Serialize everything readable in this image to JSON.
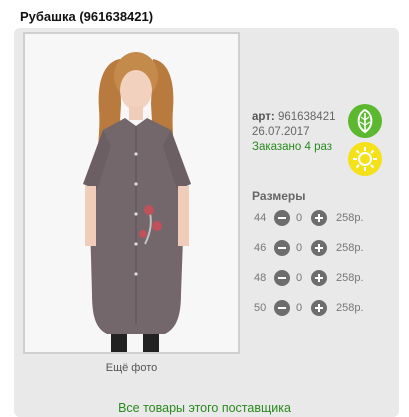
{
  "product": {
    "title": "Рубашка (961638421)",
    "article_label": "арт:",
    "article_value": "961638421",
    "date": "26.07.2017",
    "ordered": "Заказано 4 раз",
    "more_photos": "Ещё фото"
  },
  "sizes": {
    "title": "Размеры",
    "rows": [
      {
        "size": "44",
        "qty": "0",
        "price": "258р."
      },
      {
        "size": "46",
        "qty": "0",
        "price": "258р."
      },
      {
        "size": "48",
        "qty": "0",
        "price": "258р."
      },
      {
        "size": "50",
        "qty": "0",
        "price": "258р."
      }
    ]
  },
  "footer": {
    "all_goods_link": "Все товары этого поставщика"
  },
  "icons": {
    "eco": "leaf-icon",
    "season": "sun-icon"
  },
  "colors": {
    "accent_green": "#2a8a1e",
    "leaf_bg": "#5cb82f",
    "sun_bg": "#f4e11a",
    "control_grey": "#6d6d6d"
  }
}
